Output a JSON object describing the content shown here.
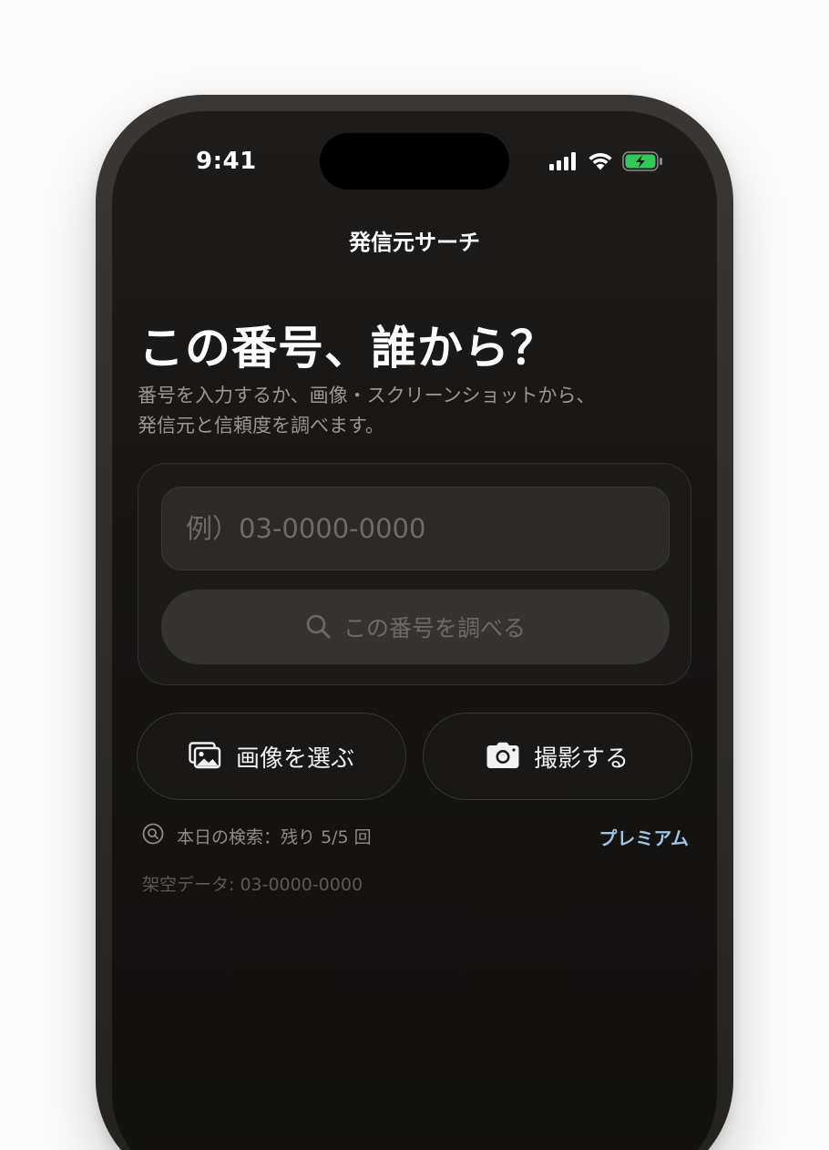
{
  "status_bar": {
    "time": "9:41",
    "icons": [
      "cellular-signal-icon",
      "wifi-icon",
      "battery-charging-icon"
    ],
    "battery_color": "#34c759"
  },
  "nav": {
    "title": "発信元サーチ"
  },
  "hero": {
    "headline": "この番号、誰から？",
    "subtitle_line1": "番号を入力するか、画像・スクリーンショットから、",
    "subtitle_line2": "発信元と信頼度を調べます。"
  },
  "search": {
    "input_value": "",
    "input_placeholder": "例）03-0000-0000",
    "button_label": "この番号を調べる",
    "button_icon": "search-icon"
  },
  "actions": {
    "choose_image_label": "画像を選ぶ",
    "choose_image_icon": "photo-library-icon",
    "take_photo_label": "撮影する",
    "take_photo_icon": "camera-icon"
  },
  "quota": {
    "icon": "search-circle-icon",
    "text": "本日の検索：残り 5/5 回",
    "premium_label": "プレミアム"
  },
  "sample": {
    "text": "架空データ: 03-0000-0000"
  },
  "colors": {
    "background": "#151413",
    "accent_link": "#9ec3e6",
    "battery": "#34c759"
  }
}
